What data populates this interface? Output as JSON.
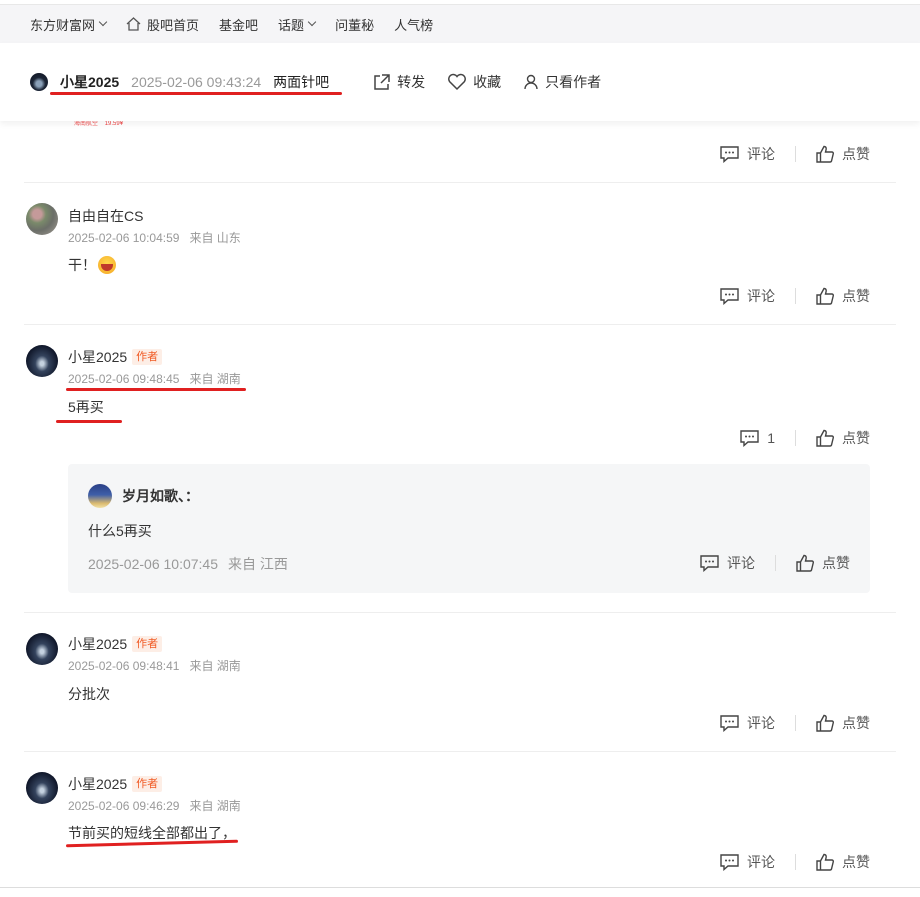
{
  "topnav": {
    "items": [
      "东方财富网",
      "股吧首页",
      "基金吧",
      "话题",
      "问董秘",
      "人气榜"
    ]
  },
  "post": {
    "author": "小星2025",
    "time": "2025-02-06 09:43:24",
    "bar": "两面针吧",
    "actions": {
      "share": "转发",
      "favorite": "收藏",
      "author_only": "只看作者"
    }
  },
  "top_stub": {
    "thumbs": [
      "海南航空",
      "19.59¥"
    ],
    "comment_label": "评论",
    "like_label": "点赞"
  },
  "comments": [
    {
      "name": "自由自在CS",
      "is_author": false,
      "time": "2025-02-06 10:04:59",
      "location": "来自 山东",
      "text": "干！",
      "comment_label": "评论",
      "like_label": "点赞"
    },
    {
      "name": "小星2025",
      "is_author": true,
      "badge": "作者",
      "time": "2025-02-06 09:48:45",
      "location": "来自 湖南",
      "text": "5再买",
      "comment_label": "1",
      "like_label": "点赞",
      "reply": {
        "name": "岁月如歌、：",
        "text": "什么5再买",
        "time": "2025-02-06 10:07:45",
        "location": "来自 江西",
        "comment_label": "评论",
        "like_label": "点赞"
      }
    },
    {
      "name": "小星2025",
      "is_author": true,
      "badge": "作者",
      "time": "2025-02-06 09:48:41",
      "location": "来自 湖南",
      "text": "分批次",
      "comment_label": "评论",
      "like_label": "点赞"
    },
    {
      "name": "小星2025",
      "is_author": true,
      "badge": "作者",
      "time": "2025-02-06 09:46:29",
      "location": "来自 湖南",
      "text": "节前买的短线全部都出了，",
      "comment_label": "评论",
      "like_label": "点赞"
    }
  ],
  "colors": {
    "annotation": "#e02020",
    "author_badge": "#f05a24"
  }
}
